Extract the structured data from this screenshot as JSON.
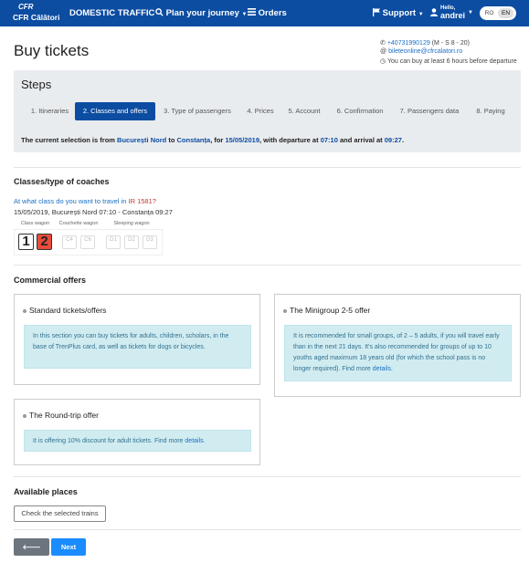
{
  "nav": {
    "logo_top": "CFR",
    "logo_text": "CFR Călători",
    "domestic": "DOMESTIC TRAFFIC",
    "plan": "Plan your journey",
    "orders": "Orders",
    "support": "Support",
    "hello": "Hello,",
    "user": "andrei",
    "lang_ro": "RO",
    "lang_en": "EN"
  },
  "page": {
    "title": "Buy tickets",
    "phone": "+40731990129",
    "phone_hours": "(M - S 8 - 20)",
    "email": "bileteonline@cfrcalatori.ro",
    "notice": "You can buy at least 6 hours before departure"
  },
  "steps": {
    "title": "Steps",
    "items": [
      "1. Itineraries",
      "2. Classes and offers",
      "3. Type of passengers",
      "4. Prices",
      "5. Account",
      "6. Confirmation",
      "7. Passengers data",
      "8. Paying"
    ],
    "active_index": 1,
    "sel_prefix": "The current selection is from",
    "sel_from": "București Nord",
    "sel_to_word": "to",
    "sel_to": "Constanța",
    "sel_for": ", for",
    "sel_date": "15/05/2019",
    "sel_dep_word": ", with departure at",
    "sel_dep": "07:10",
    "sel_arr_word": "and arrival at",
    "sel_arr": "09:27",
    "sel_end": "."
  },
  "classes": {
    "heading": "Classes/type of coaches",
    "question": "At what class do you want to travel in",
    "train": "IR 1581?",
    "route": "15/05/2019, București Nord 07:10 - Constanța 09:27",
    "tab_class": "Class wagon",
    "tab_couchette": "Couchette wagon",
    "tab_sleeping": "Sleeping wagon",
    "class1": "1",
    "class2": "2",
    "c4": "C4",
    "c6": "C6",
    "d1": "D1",
    "d2": "D2",
    "d3": "D3"
  },
  "offers": {
    "heading": "Commercial offers",
    "standard_title": "Standard tickets/offers",
    "standard_text": "In this section you can buy tickets for adults, children, scholars, in the base of TrenPlus card, as well as tickets for dogs or bicycles.",
    "minigroup_title": "The Minigroup 2-5 offer",
    "minigroup_text": "It is recommended for small groups, of 2 – 5 adults, if you will travel early than in the next 21 days. It's also recommended for groups of up to 10 youths aged maximum 18 years old (for which the school pass is no longer required). Find more",
    "minigroup_link": "details.",
    "roundtrip_title": "The Round-trip offer",
    "roundtrip_text": "It is offering 10% discount for adult tickets. Find more",
    "roundtrip_link": "details."
  },
  "places": {
    "heading": "Available places",
    "check_button": "Check the selected trains"
  },
  "buttons": {
    "back": "Back",
    "next": "Next"
  },
  "colors": {
    "primary": "#0c4da2",
    "info_bg": "#d1ecf1",
    "class2": "#e74c3c",
    "next": "#1a8cff"
  }
}
